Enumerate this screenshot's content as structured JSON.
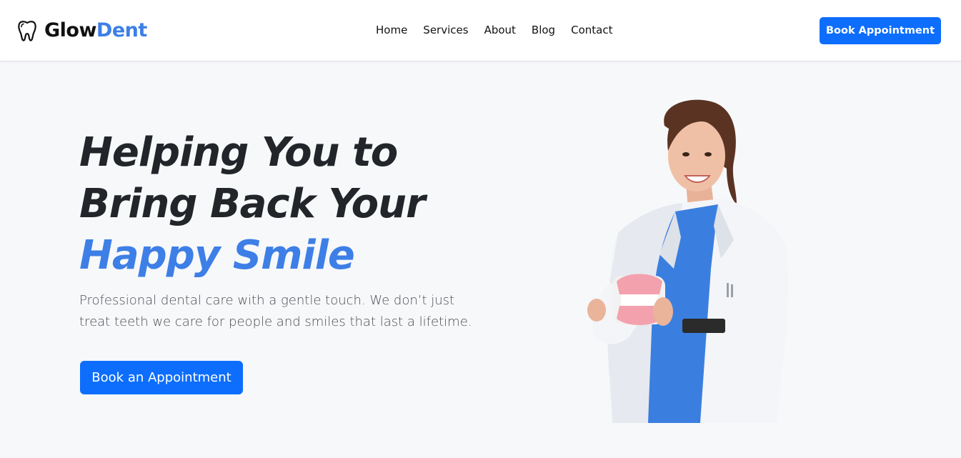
{
  "brand": {
    "name_part1": "Glow",
    "name_part2": "Dent",
    "icon": "tooth-icon",
    "accent_color": "#3d7fe6"
  },
  "nav": {
    "items": [
      {
        "label": "Home"
      },
      {
        "label": "Services"
      },
      {
        "label": "About"
      },
      {
        "label": "Blog"
      },
      {
        "label": "Contact"
      }
    ],
    "cta_label": "Book Appointment"
  },
  "hero": {
    "title_line1": "Helping You to",
    "title_line2": "Bring Back Your",
    "title_highlight": "Happy Smile",
    "description": "Professional dental care with a gentle touch. We don’t just treat teeth we care for people and smiles that last a lifetime.",
    "cta_label": "Book an Appointment",
    "image": "dentist-holding-teeth-model"
  },
  "colors": {
    "primary_button": "#0d6efd",
    "accent_text": "#3d7fe6",
    "page_background": "#f7f8fa",
    "heading": "#222529"
  }
}
